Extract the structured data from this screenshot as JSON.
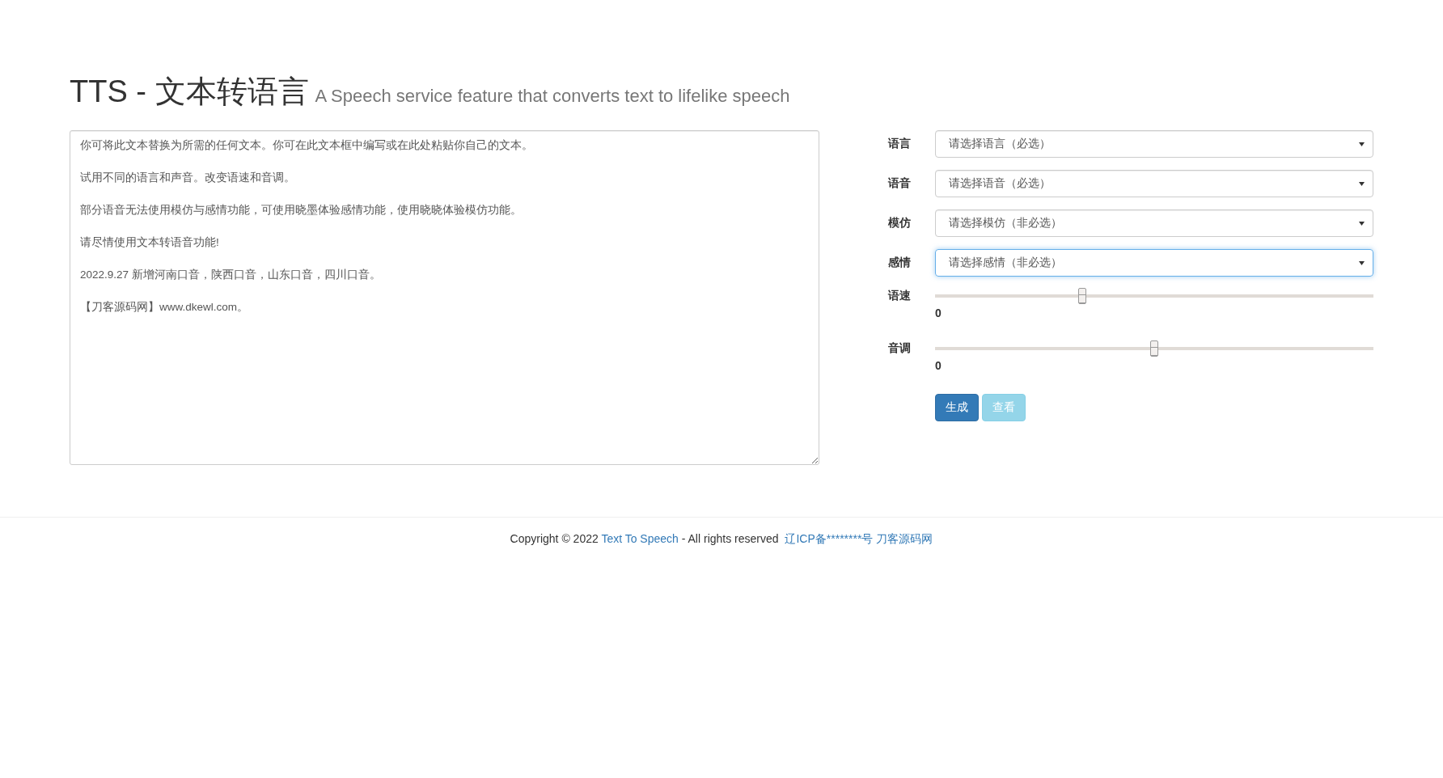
{
  "header": {
    "title": "TTS - 文本转语言",
    "subtitle": "A Speech service feature that converts text to lifelike speech"
  },
  "text_input": {
    "paragraphs": [
      "你可将此文本替换为所需的任何文本。你可在此文本框中编写或在此处粘贴你自己的文本。",
      "试用不同的语言和声音。改变语速和音调。",
      "部分语音无法使用模仿与感情功能，可使用晓墨体验感情功能，使用晓晓体验模仿功能。",
      "请尽情使用文本转语音功能!",
      "2022.9.27 新增河南口音，陕西口音，山东口音，四川口音。",
      "【刀客源码网】www.dkewl.com。"
    ]
  },
  "form": [
    {
      "kind": "select",
      "label": "语言",
      "placeholder": "请选择语言（必选）",
      "focused": false
    },
    {
      "kind": "select",
      "label": "语音",
      "placeholder": "请选择语音（必选）",
      "focused": false
    },
    {
      "kind": "select",
      "label": "模仿",
      "placeholder": "请选择模仿（非必选）",
      "focused": false
    },
    {
      "kind": "select",
      "label": "感情",
      "placeholder": "请选择感情（非必选）",
      "focused": true
    },
    {
      "kind": "slider",
      "label": "语速",
      "level": 0.335,
      "reading": "0"
    },
    {
      "kind": "slider",
      "label": "音调",
      "level": 0.5,
      "reading": "0"
    }
  ],
  "buttons": [
    {
      "label": "生成",
      "disabled": false
    },
    {
      "label": "查看",
      "disabled": true
    }
  ],
  "footer": [
    {
      "kind": "text",
      "text": "Copyright © 2022 "
    },
    {
      "kind": "link",
      "text": "Text To Speech"
    },
    {
      "kind": "text",
      "text": " - All rights reserved "
    },
    {
      "kind": "link",
      "text": "辽ICP备********号"
    },
    {
      "kind": "link",
      "text": "刀客源码网"
    }
  ]
}
